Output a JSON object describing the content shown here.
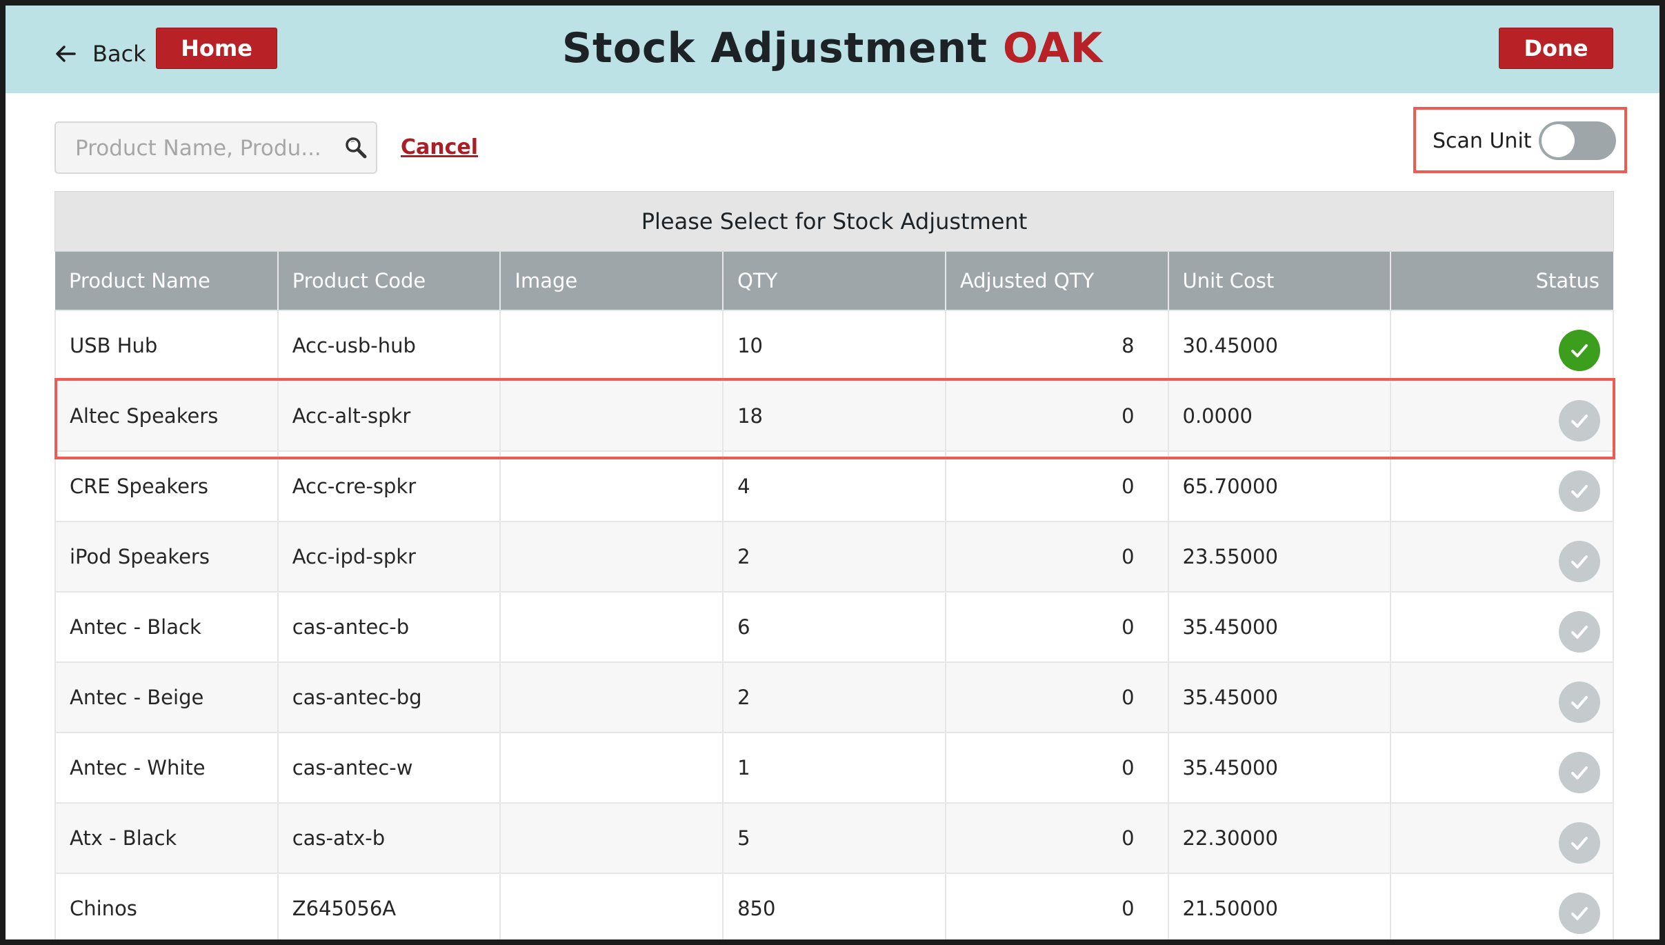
{
  "header": {
    "back_label": "Back",
    "home_label": "Home",
    "title_main": "Stock Adjustment ",
    "title_accent": "OAK",
    "done_label": "Done"
  },
  "search": {
    "placeholder": "Product Name, Produ...",
    "value": "",
    "cancel_label": "Cancel"
  },
  "scan_unit": {
    "label": "Scan Unit",
    "enabled": false
  },
  "table": {
    "caption": "Please Select for Stock Adjustment",
    "columns": [
      "Product Name",
      "Product Code",
      "Image",
      "QTY",
      "Adjusted QTY",
      "Unit Cost",
      "Status"
    ],
    "rows": [
      {
        "name": "USB Hub",
        "code": "Acc-usb-hub",
        "image": "",
        "qty": "10",
        "adjusted": "8",
        "cost": "30.45000",
        "status": "done"
      },
      {
        "name": "Altec Speakers",
        "code": "Acc-alt-spkr",
        "image": "",
        "qty": "18",
        "adjusted": "0",
        "cost": "0.0000",
        "status": "pending"
      },
      {
        "name": "CRE Speakers",
        "code": "Acc-cre-spkr",
        "image": "",
        "qty": "4",
        "adjusted": "0",
        "cost": "65.70000",
        "status": "pending"
      },
      {
        "name": "iPod Speakers",
        "code": "Acc-ipd-spkr",
        "image": "",
        "qty": "2",
        "adjusted": "0",
        "cost": "23.55000",
        "status": "pending"
      },
      {
        "name": "Antec - Black",
        "code": "cas-antec-b",
        "image": "",
        "qty": "6",
        "adjusted": "0",
        "cost": "35.45000",
        "status": "pending"
      },
      {
        "name": "Antec - Beige",
        "code": "cas-antec-bg",
        "image": "",
        "qty": "2",
        "adjusted": "0",
        "cost": "35.45000",
        "status": "pending"
      },
      {
        "name": "Antec - White",
        "code": "cas-antec-w",
        "image": "",
        "qty": "1",
        "adjusted": "0",
        "cost": "35.45000",
        "status": "pending"
      },
      {
        "name": "Atx - Black",
        "code": "cas-atx-b",
        "image": "",
        "qty": "5",
        "adjusted": "0",
        "cost": "22.30000",
        "status": "pending"
      },
      {
        "name": "Chinos",
        "code": "Z645056A",
        "image": "",
        "qty": "850",
        "adjusted": "0",
        "cost": "21.50000",
        "status": "pending"
      }
    ]
  },
  "colors": {
    "header_bg": "#bde2e6",
    "brand_red": "#b82227",
    "highlight": "#ee5b53",
    "status_done": "#3b9e1c",
    "status_pending": "#c5cacd"
  },
  "icons": {
    "back": "arrow-left-icon",
    "search": "magnifier-icon",
    "status": "check-circle-icon"
  }
}
